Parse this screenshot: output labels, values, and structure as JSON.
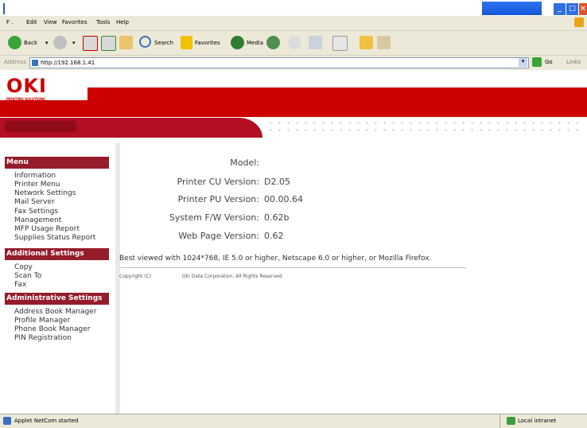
{
  "menubar": {
    "items": [
      "F .",
      "Edit",
      "View",
      "Favorites",
      "Tools",
      "Help"
    ]
  },
  "toolbar": {
    "back": "Back",
    "search": "Search",
    "favorites": "Favorites",
    "media": "Media"
  },
  "address": {
    "label": "Address",
    "url": "http://192.168.1.41",
    "go": "Go",
    "links": "Links"
  },
  "brand": {
    "logo": "OKI",
    "tagline": "PRINTING SOLUTIONS"
  },
  "sidebar": {
    "menu_title": "Menu",
    "menu_items": [
      "Information",
      "Printer Menu",
      "Network Settings",
      "Mail Server",
      "Fax Settings",
      "Management",
      "MFP Usage Report",
      "Supplies Status Report"
    ],
    "additional_title": "Additional Settings",
    "additional_items": [
      "Copy",
      "Scan To",
      "Fax"
    ],
    "admin_title": "Administrative Settings",
    "admin_items": [
      "Address Book Manager",
      "Profile Manager",
      "Phone Book Manager",
      "PIN Registration"
    ]
  },
  "info": {
    "rows": [
      {
        "label": "Model:",
        "value": ""
      },
      {
        "label": "Printer CU Version:",
        "value": "D2.05"
      },
      {
        "label": "Printer PU Version:",
        "value": "00.00.64"
      },
      {
        "label": "System F/W Version:",
        "value": "0.62b"
      },
      {
        "label": "Web Page Version:",
        "value": "0.62"
      }
    ]
  },
  "footer": {
    "best_view": "Best viewed with 1024*768, IE 5.0 or higher, Netscape 6.0 or higher, or Mozilla Firefox.",
    "copyright_label": "Copyright (C)",
    "copyright_holder": "Oki Data Corporation. All Rights Reserved."
  },
  "status": {
    "left": "Applet NetCom started",
    "zone": "Local intranet"
  },
  "colors": {
    "brand_red": "#cc0000",
    "section_red": "#951c2a"
  }
}
